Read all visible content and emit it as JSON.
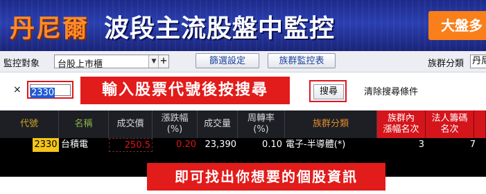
{
  "banner": {
    "brand": "丹尼爾",
    "title": "波段主流股盤中監控",
    "right_button": "大盤多"
  },
  "filter_bar": {
    "monitor_label": "監控對象",
    "monitor_value": "台股上市櫃",
    "filter_settings": "篩選設定",
    "group_monitor": "族群監控表",
    "group_class_label": "族群分類",
    "group_class_value": "丹尼"
  },
  "search": {
    "close": "×",
    "input_value": "2330",
    "callout": "輸入股票代號後按搜尋",
    "search_button": "搜尋",
    "clear_conditions": "清除搜尋條件"
  },
  "table": {
    "headers": {
      "code": "代號",
      "name": "名稱",
      "price": "成交價",
      "change_pct_line1": "漲跌幅",
      "change_pct_line2": "(%)",
      "volume": "成交量",
      "turnover_line1": "周轉率",
      "turnover_line2": "(%)",
      "group": "族群分類",
      "group_rank_line1": "族群內",
      "group_rank_line2": "漲幅名次",
      "inst_rank_line1": "法人籌碼",
      "inst_rank_line2": "名次"
    },
    "rows": [
      {
        "code": "2330",
        "name": "台積電",
        "price": "250.5",
        "change_pct": "0.20",
        "volume": "23,390",
        "turnover": "0.10",
        "group": "電子-半導體(*)",
        "group_rank": "3",
        "inst_rank": "7"
      }
    ]
  },
  "bottom_callout": "即可找出你想要的個股資訊",
  "colors": {
    "banner_bg": "#1d2a8a",
    "brand": "#ff8a2a",
    "accent_orange": "#f97f1b",
    "callout_red": "#e21b1b",
    "header_bg": "#1d1f25",
    "code_highlight": "#f5c518",
    "price_red": "#e0141c"
  }
}
